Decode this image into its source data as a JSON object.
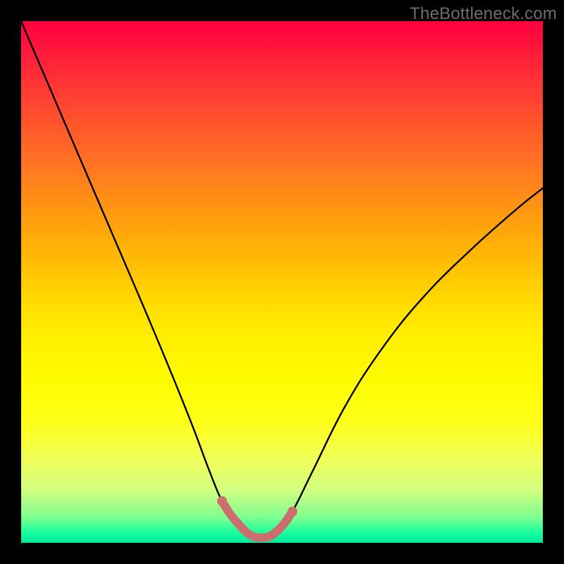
{
  "watermark": "TheBottleneck.com",
  "chart_data": {
    "type": "line",
    "title": "",
    "xlabel": "",
    "ylabel": "",
    "xlim": [
      0,
      1
    ],
    "ylim": [
      0,
      1
    ],
    "series": [
      {
        "name": "curve",
        "x": [
          0.0,
          0.06,
          0.12,
          0.18,
          0.24,
          0.29,
          0.33,
          0.36,
          0.385,
          0.41,
          0.44,
          0.47,
          0.495,
          0.52,
          0.56,
          0.62,
          0.69,
          0.77,
          0.86,
          0.95,
          1.0
        ],
        "y": [
          1.0,
          0.86,
          0.72,
          0.58,
          0.44,
          0.32,
          0.22,
          0.14,
          0.08,
          0.04,
          0.01,
          0.01,
          0.025,
          0.06,
          0.14,
          0.26,
          0.37,
          0.47,
          0.56,
          0.64,
          0.68
        ]
      },
      {
        "name": "highlight",
        "x": [
          0.385,
          0.4,
          0.415,
          0.43,
          0.445,
          0.46,
          0.475,
          0.49,
          0.505,
          0.52
        ],
        "y": [
          0.08,
          0.056,
          0.038,
          0.022,
          0.012,
          0.01,
          0.012,
          0.022,
          0.038,
          0.06
        ]
      }
    ],
    "colors": {
      "curve": "#000000",
      "highlight": "#cc6e6e",
      "highlight_fill": "#cc6e6e"
    }
  }
}
